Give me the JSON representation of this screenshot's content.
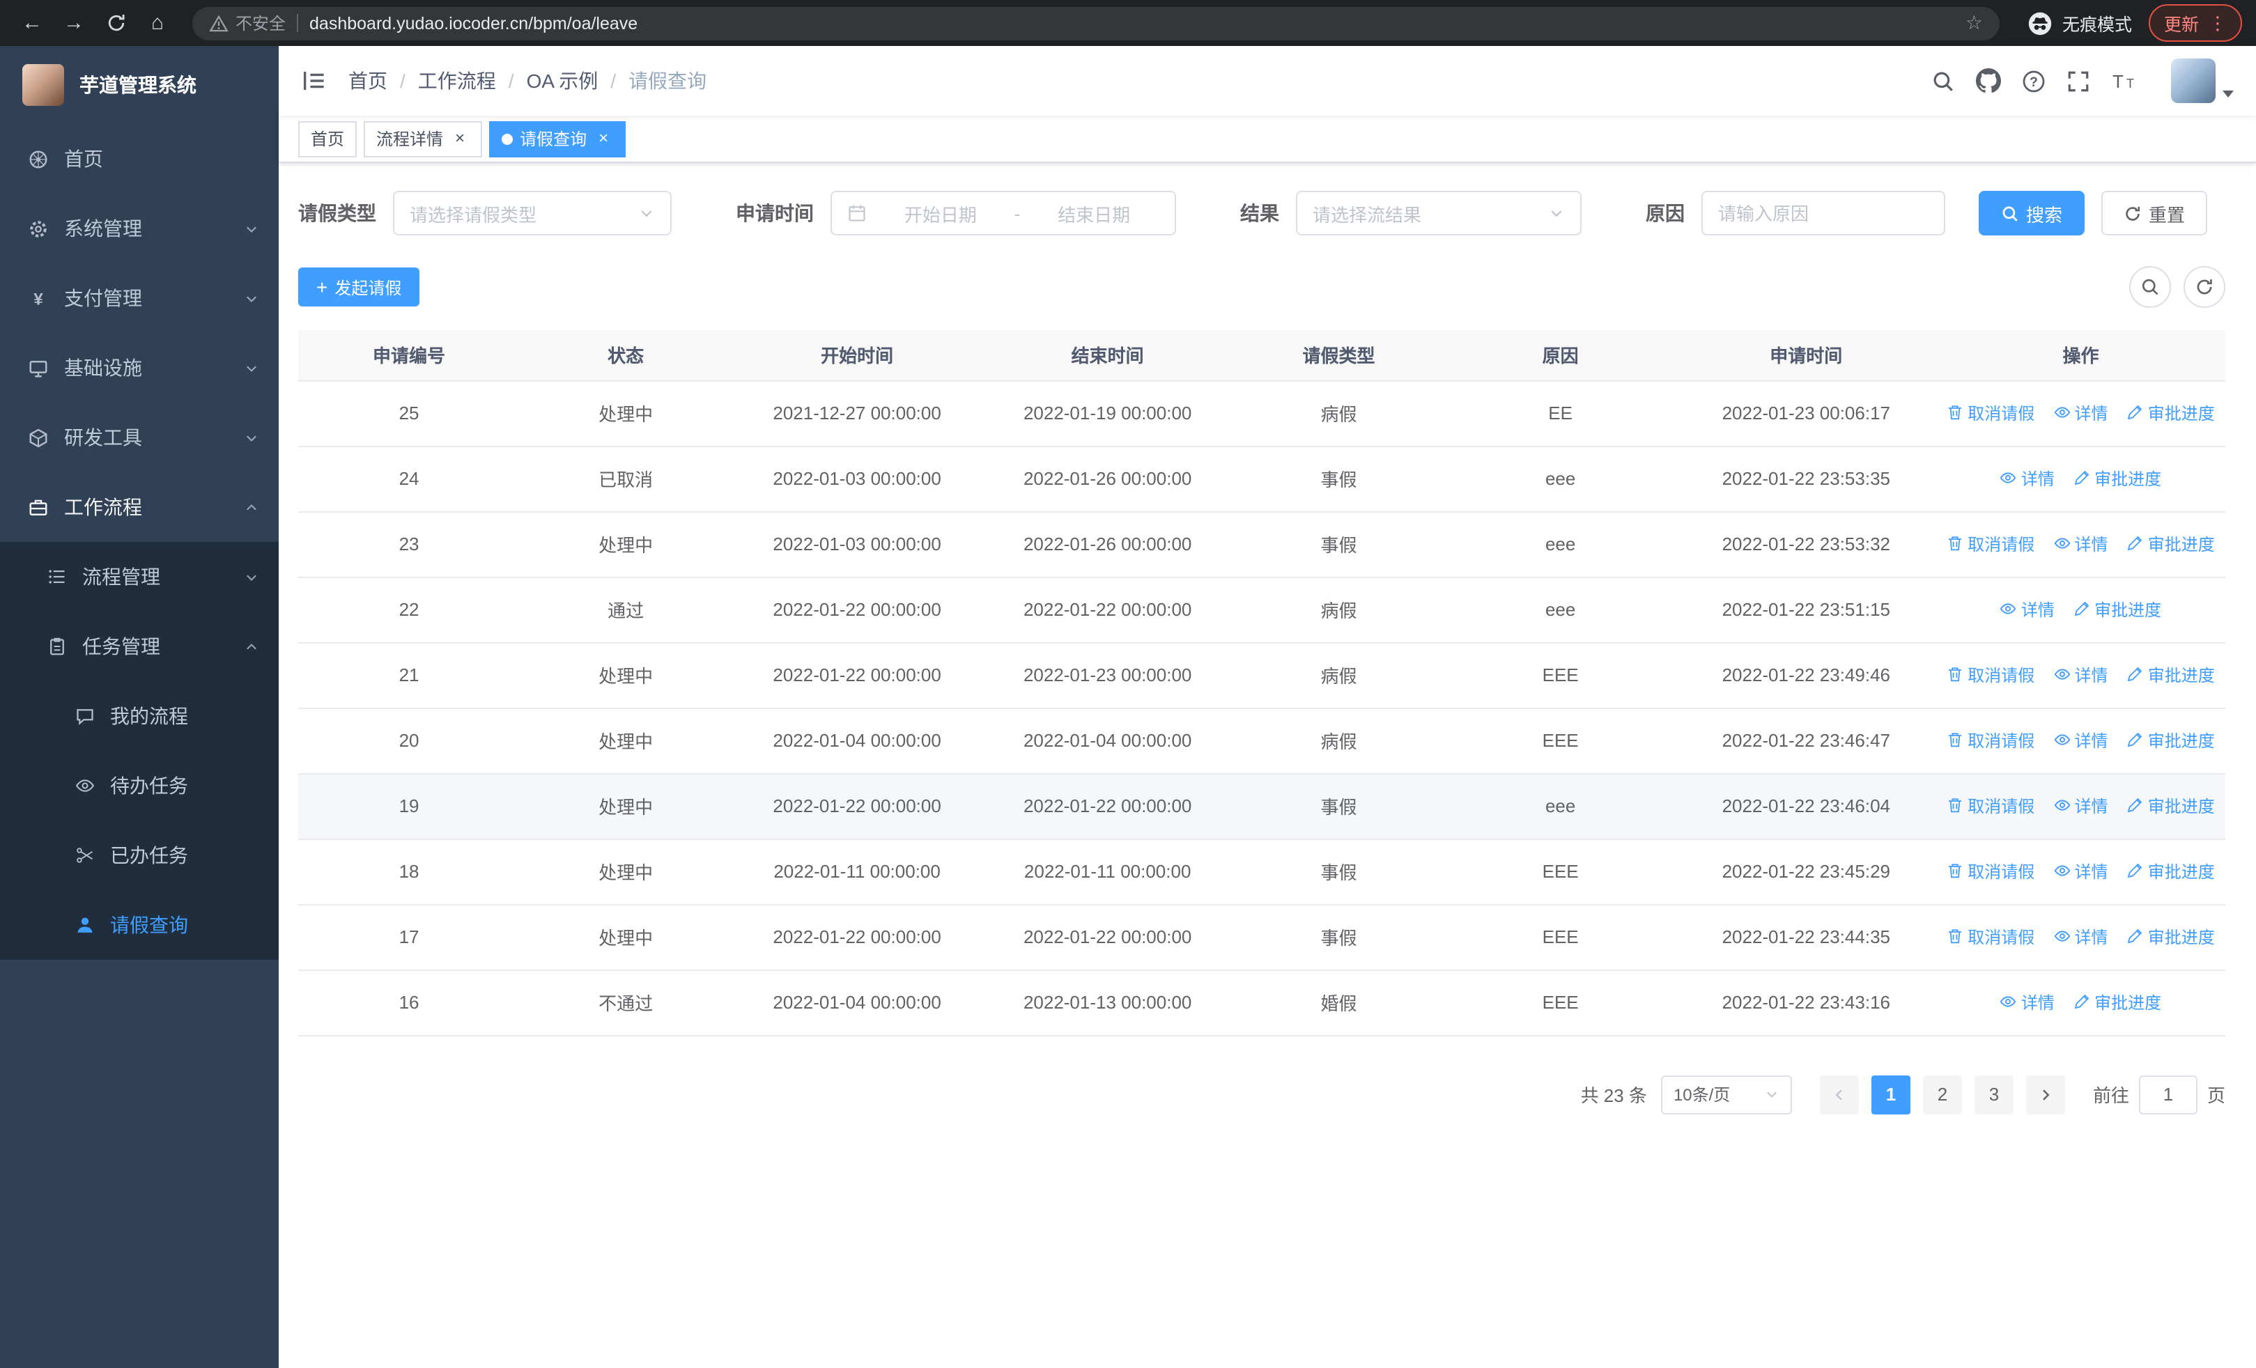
{
  "browser": {
    "security_label": "不安全",
    "url": "dashboard.yudao.iocoder.cn/bpm/oa/leave",
    "incognito_label": "无痕模式",
    "update_label": "更新"
  },
  "sidebar": {
    "title": "芋道管理系统",
    "items": [
      {
        "label": "首页"
      },
      {
        "label": "系统管理"
      },
      {
        "label": "支付管理"
      },
      {
        "label": "基础设施"
      },
      {
        "label": "研发工具"
      },
      {
        "label": "工作流程"
      }
    ],
    "workflow_children": [
      {
        "label": "流程管理"
      },
      {
        "label": "任务管理"
      }
    ],
    "task_children": [
      {
        "label": "我的流程"
      },
      {
        "label": "待办任务"
      },
      {
        "label": "已办任务"
      },
      {
        "label": "请假查询"
      }
    ]
  },
  "navbar": {
    "breadcrumb": [
      "首页",
      "工作流程",
      "OA 示例",
      "请假查询"
    ]
  },
  "tabs": [
    {
      "label": "首页"
    },
    {
      "label": "流程详情"
    },
    {
      "label": "请假查询"
    }
  ],
  "filters": {
    "leave_type_label": "请假类型",
    "leave_type_placeholder": "请选择请假类型",
    "apply_time_label": "申请时间",
    "start_placeholder": "开始日期",
    "range_separator": "-",
    "end_placeholder": "结束日期",
    "result_label": "结果",
    "result_placeholder": "请选择流结果",
    "reason_label": "原因",
    "reason_placeholder": "请输入原因",
    "search_label": "搜索",
    "reset_label": "重置"
  },
  "toolbar": {
    "create_label": "发起请假"
  },
  "table": {
    "columns": [
      "申请编号",
      "状态",
      "开始时间",
      "结束时间",
      "请假类型",
      "原因",
      "申请时间",
      "操作"
    ],
    "action_labels": {
      "cancel": "取消请假",
      "detail": "详情",
      "progress": "审批进度"
    },
    "rows": [
      {
        "id": "25",
        "status": "处理中",
        "start": "2021-12-27 00:00:00",
        "end": "2022-01-19 00:00:00",
        "type": "病假",
        "reason": "EE",
        "applied": "2022-01-23 00:06:17",
        "actions": [
          "cancel",
          "detail",
          "progress"
        ]
      },
      {
        "id": "24",
        "status": "已取消",
        "start": "2022-01-03 00:00:00",
        "end": "2022-01-26 00:00:00",
        "type": "事假",
        "reason": "eee",
        "applied": "2022-01-22 23:53:35",
        "actions": [
          "detail",
          "progress"
        ]
      },
      {
        "id": "23",
        "status": "处理中",
        "start": "2022-01-03 00:00:00",
        "end": "2022-01-26 00:00:00",
        "type": "事假",
        "reason": "eee",
        "applied": "2022-01-22 23:53:32",
        "actions": [
          "cancel",
          "detail",
          "progress"
        ]
      },
      {
        "id": "22",
        "status": "通过",
        "start": "2022-01-22 00:00:00",
        "end": "2022-01-22 00:00:00",
        "type": "病假",
        "reason": "eee",
        "applied": "2022-01-22 23:51:15",
        "actions": [
          "detail",
          "progress"
        ]
      },
      {
        "id": "21",
        "status": "处理中",
        "start": "2022-01-22 00:00:00",
        "end": "2022-01-23 00:00:00",
        "type": "病假",
        "reason": "EEE",
        "applied": "2022-01-22 23:49:46",
        "actions": [
          "cancel",
          "detail",
          "progress"
        ]
      },
      {
        "id": "20",
        "status": "处理中",
        "start": "2022-01-04 00:00:00",
        "end": "2022-01-04 00:00:00",
        "type": "病假",
        "reason": "EEE",
        "applied": "2022-01-22 23:46:47",
        "actions": [
          "cancel",
          "detail",
          "progress"
        ]
      },
      {
        "id": "19",
        "status": "处理中",
        "start": "2022-01-22 00:00:00",
        "end": "2022-01-22 00:00:00",
        "type": "事假",
        "reason": "eee",
        "applied": "2022-01-22 23:46:04",
        "actions": [
          "cancel",
          "detail",
          "progress"
        ],
        "highlight": true
      },
      {
        "id": "18",
        "status": "处理中",
        "start": "2022-01-11 00:00:00",
        "end": "2022-01-11 00:00:00",
        "type": "事假",
        "reason": "EEE",
        "applied": "2022-01-22 23:45:29",
        "actions": [
          "cancel",
          "detail",
          "progress"
        ]
      },
      {
        "id": "17",
        "status": "处理中",
        "start": "2022-01-22 00:00:00",
        "end": "2022-01-22 00:00:00",
        "type": "事假",
        "reason": "EEE",
        "applied": "2022-01-22 23:44:35",
        "actions": [
          "cancel",
          "detail",
          "progress"
        ]
      },
      {
        "id": "16",
        "status": "不通过",
        "start": "2022-01-04 00:00:00",
        "end": "2022-01-13 00:00:00",
        "type": "婚假",
        "reason": "EEE",
        "applied": "2022-01-22 23:43:16",
        "actions": [
          "detail",
          "progress"
        ]
      }
    ]
  },
  "pagination": {
    "total": "共 23 条",
    "page_size": "10条/页",
    "pages": [
      "1",
      "2",
      "3"
    ],
    "active_page": "1",
    "goto_prefix": "前往",
    "goto_value": "1",
    "goto_suffix": "页"
  },
  "colors": {
    "primary": "#409eff",
    "sidebar_bg": "#304156",
    "sidebar_submenu_bg": "#1f2d3d"
  }
}
